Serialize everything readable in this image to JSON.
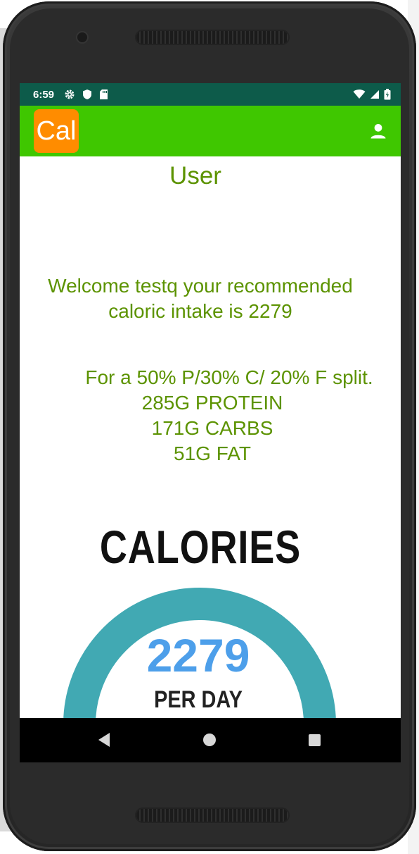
{
  "status_bar": {
    "time": "6:59",
    "left_icons": [
      "settings-icon",
      "shield-icon",
      "sd-card-icon"
    ],
    "right_icons": [
      "wifi-icon",
      "signal-icon",
      "battery-icon"
    ],
    "color": "#0d5b4a"
  },
  "app_bar": {
    "logo_text": "Cal",
    "logo_color": "#ff8c00",
    "background": "#3fc700",
    "action_icon": "account-icon"
  },
  "page": {
    "title": "User",
    "welcome": "Welcome testq your recommended caloric intake is 2279",
    "split_line": "For a 50% P/30% C/ 20% F split.",
    "protein": "285G PROTEIN",
    "carbs": "171G CARBS",
    "fat": "51G FAT",
    "text_color": "#5c9300"
  },
  "calories_graphic": {
    "heading": "CALORIES",
    "value": "2279",
    "unit": "PER DAY",
    "ring_color": "#41a9b3",
    "value_color": "#4d9fea"
  },
  "nav_bar": {
    "buttons": [
      "back-icon",
      "home-icon",
      "recents-icon"
    ]
  }
}
